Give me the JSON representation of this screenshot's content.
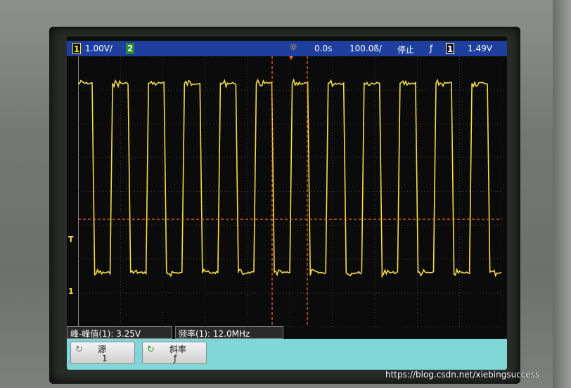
{
  "status_bar": {
    "ch1_number": "1",
    "ch1_scale": "1.00V/",
    "ch2_number": "2",
    "time_delay": "0.0s",
    "time_scale": "100.0ß/",
    "run_state": "停止",
    "trigger_slope_symbol": "ƒ",
    "trigger_source": "1",
    "trigger_level": "1.49V"
  },
  "markers": {
    "trigger_marker": "T",
    "ground_marker": "1"
  },
  "measurements": {
    "peak_to_peak_label": "峰-峰值(1):",
    "peak_to_peak_value": "3.25V",
    "frequency_label": "频率(1):",
    "frequency_value": "12.0MHz"
  },
  "softkeys": [
    {
      "title": "源",
      "value": "1"
    },
    {
      "title": "斜率",
      "value": "ƒ"
    }
  ],
  "colors": {
    "trace": "#f4dc4a",
    "cursor": "#ff6a2a",
    "status_bar": "#1f3f9e",
    "softkey_bar": "#7fd7d8"
  },
  "waveform": {
    "type": "square",
    "periods_visible": 12,
    "duty_cycle": 0.5,
    "high_level": 1,
    "low_level": -0.5
  },
  "watermark": "https://blog.csdn.net/xiebingsuccess"
}
